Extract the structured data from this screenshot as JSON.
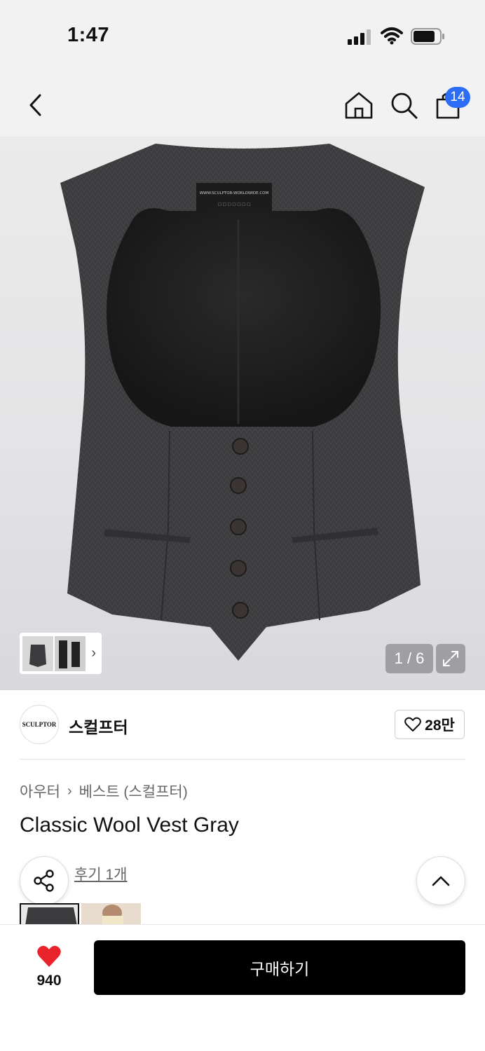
{
  "status_bar": {
    "time": "1:47"
  },
  "header": {
    "cart_count": "14"
  },
  "gallery": {
    "counter": "1 / 6",
    "label_text": "WWW.SCULPTOR-WORLDWIDE.COM"
  },
  "brand": {
    "logo_text": "SCULPTOR",
    "name": "스컬프터",
    "likes": "28만"
  },
  "product": {
    "breadcrumb": [
      "아우터",
      "베스트 (스컬프터)"
    ],
    "title": "Classic Wool Vest Gray",
    "review_text": "후기 1개"
  },
  "bottom": {
    "like_count": "940",
    "buy_label": "구매하기"
  },
  "colors": {
    "accent": "#2d6cf5",
    "like_red": "#e8232b",
    "vest": "#3a3a3c"
  }
}
